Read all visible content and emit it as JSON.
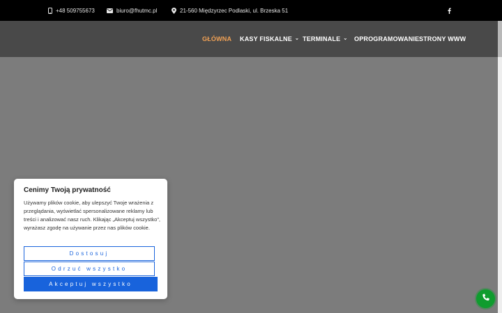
{
  "topbar": {
    "phone": "+48 509755673",
    "email": "biuro@fhutmc.pl",
    "address": "21-560 Międzyrzec Podlaski, ul. Brzeska 51",
    "social_icon": "facebook-icon"
  },
  "nav": {
    "items": [
      {
        "label": "GŁÓWNA",
        "active": true
      },
      {
        "label": "KASY FISKALNE",
        "dropdown": true
      },
      {
        "label": "TERMINALE",
        "dropdown": true
      },
      {
        "label": "OPROGRAMOWANIE"
      },
      {
        "label": "STRONY WWW"
      }
    ],
    "active_color": "#f0a155"
  },
  "cookie": {
    "title": "Cenimy Twoją prywatność",
    "text": "Używamy plików cookie, aby ulepszyć Twoje wrażenia z przeglądania, wyświetlać spersonalizowane reklamy lub treści i analizować nasz ruch. Klikając „Akceptuj wszystko”, wyrażasz zgodę na używanie przez nas plików cookie.",
    "customize_label": "Dostosuj",
    "reject_label": "Odrzuć wszystko",
    "accept_label": "Akceptuj wszystko",
    "accent_color": "#1863dc"
  },
  "call_button": {
    "icon": "phone-icon",
    "color": "#0f9c2e"
  }
}
